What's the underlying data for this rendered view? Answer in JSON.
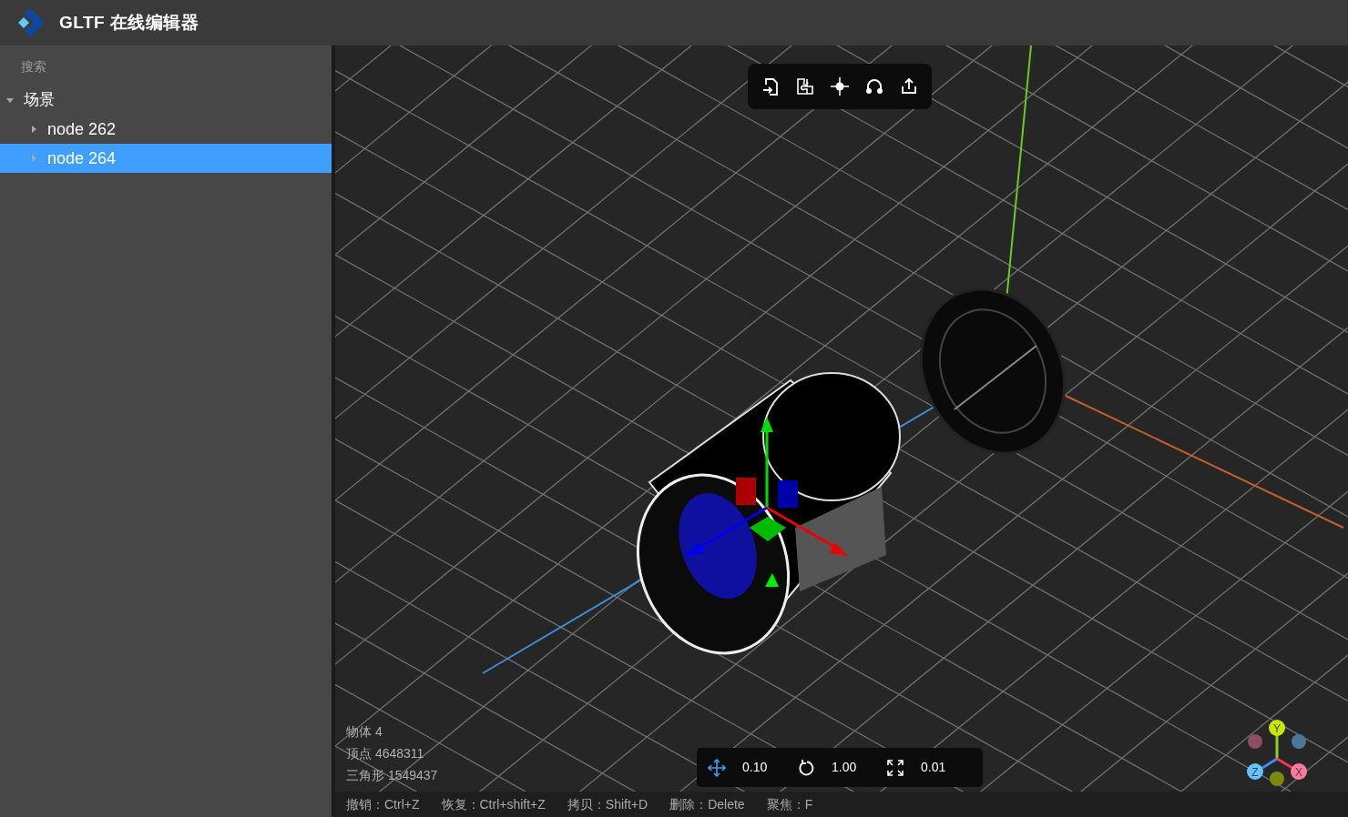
{
  "app": {
    "title": "GLTF 在线编辑器"
  },
  "sidebar": {
    "search": {
      "placeholder": "搜索"
    },
    "tree": [
      {
        "label": "场景",
        "expanded": true,
        "selected": false,
        "children": [
          {
            "label": "node 262",
            "expanded": false,
            "selected": false
          },
          {
            "label": "node 264",
            "expanded": false,
            "selected": true
          }
        ]
      }
    ]
  },
  "stats": [
    "物体 4",
    "顶点 4648311",
    "三角形 1549437"
  ],
  "snap": [
    {
      "kind": "translate",
      "value": "0.10"
    },
    {
      "kind": "rotate",
      "value": "1.00"
    },
    {
      "kind": "scale",
      "value": "0.01"
    }
  ],
  "shortcuts": [
    "撤销：Ctrl+Z",
    "恢复：Ctrl+shift+Z",
    "拷贝：Shift+D",
    "删除：Delete",
    "聚焦：F"
  ],
  "axis_gizmo": {
    "labels": [
      {
        "kind": "y",
        "label": "Y"
      },
      {
        "kind": "z",
        "label": "Z"
      },
      {
        "kind": "x",
        "label": "X"
      }
    ]
  }
}
